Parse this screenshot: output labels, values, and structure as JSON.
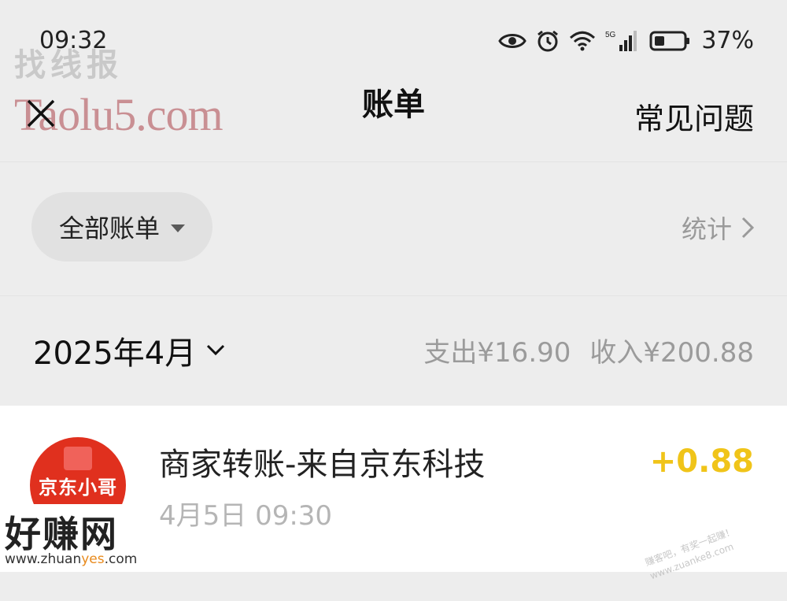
{
  "status_bar": {
    "time": "09:32",
    "network": "5G",
    "battery": "37%",
    "icons": [
      "eye-icon",
      "alarm-icon",
      "wifi-icon",
      "signal-icon",
      "battery-icon"
    ]
  },
  "watermarks": {
    "top_left_cn": "找线报",
    "top_left_en": "Taolu5.com",
    "bottom_left_cn": "好赚网",
    "bottom_left_url_a": "www.zhuan",
    "bottom_left_url_b": "yes",
    "bottom_left_url_c": ".com",
    "bottom_right_a": "赚客吧，有奖一起赚！",
    "bottom_right_b": "www.zuanke8.com"
  },
  "nav": {
    "title": "账单",
    "faq_label": "常见问题",
    "close_icon": "close-icon"
  },
  "filter": {
    "selected": "全部账单",
    "stats_label": "统计"
  },
  "month": {
    "label": "2025年4月",
    "expense_label": "支出",
    "expense_value": "¥16.90",
    "income_label": "收入",
    "income_value": "¥200.88"
  },
  "bills": [
    {
      "logo_text": "京东小哥",
      "title": "商家转账-来自京东科技",
      "time": "4月5日 09:30",
      "amount": "+0.88"
    }
  ],
  "colors": {
    "background": "#ededed",
    "income_amount": "#f0c419",
    "logo_red": "#e0301e"
  }
}
